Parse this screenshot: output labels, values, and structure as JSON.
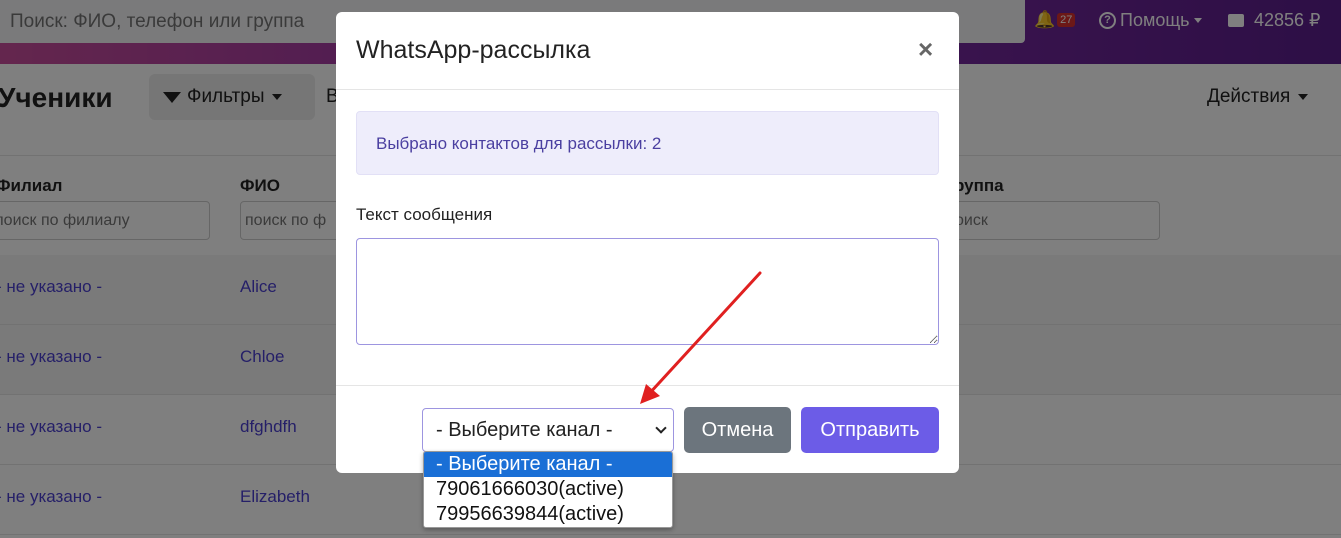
{
  "topbar": {
    "search_placeholder": "Поиск: ФИО, телефон или группа",
    "notifications_count": "27",
    "help_label": "Помощь",
    "balance": "42856 ₽"
  },
  "page": {
    "title": "Ученики",
    "filters_label": "Фильтры",
    "truncated_label": "В",
    "actions_label": "Действия"
  },
  "table": {
    "headers": {
      "branch": "Филиал",
      "name": "ФИО",
      "group": "руппа"
    },
    "filters": {
      "branch": "поиск по филиалу",
      "name": "поиск по ф",
      "group": "оиск"
    },
    "rows": [
      {
        "branch": "- не указано -",
        "name": "Alice"
      },
      {
        "branch": "- не указано -",
        "name": "Chloe"
      },
      {
        "branch": "- не указано -",
        "name": "dfghdfh"
      },
      {
        "branch": "- не указано -",
        "name": "Elizabeth"
      }
    ]
  },
  "modal": {
    "title": "WhatsApp-рассылка",
    "close": "×",
    "info": "Выбрано контактов для рассылки: 2",
    "message_label": "Текст сообщения",
    "message_value": "",
    "channel_selected": "- Выберите канал -",
    "channel_options": [
      "- Выберите канал -",
      "79061666030(active)",
      "79956639844(active)"
    ],
    "cancel_label": "Отмена",
    "send_label": "Отправить"
  },
  "colors": {
    "primary": "#6c5ce7",
    "secondary": "#6c757d",
    "annotation_arrow": "#e02020"
  }
}
